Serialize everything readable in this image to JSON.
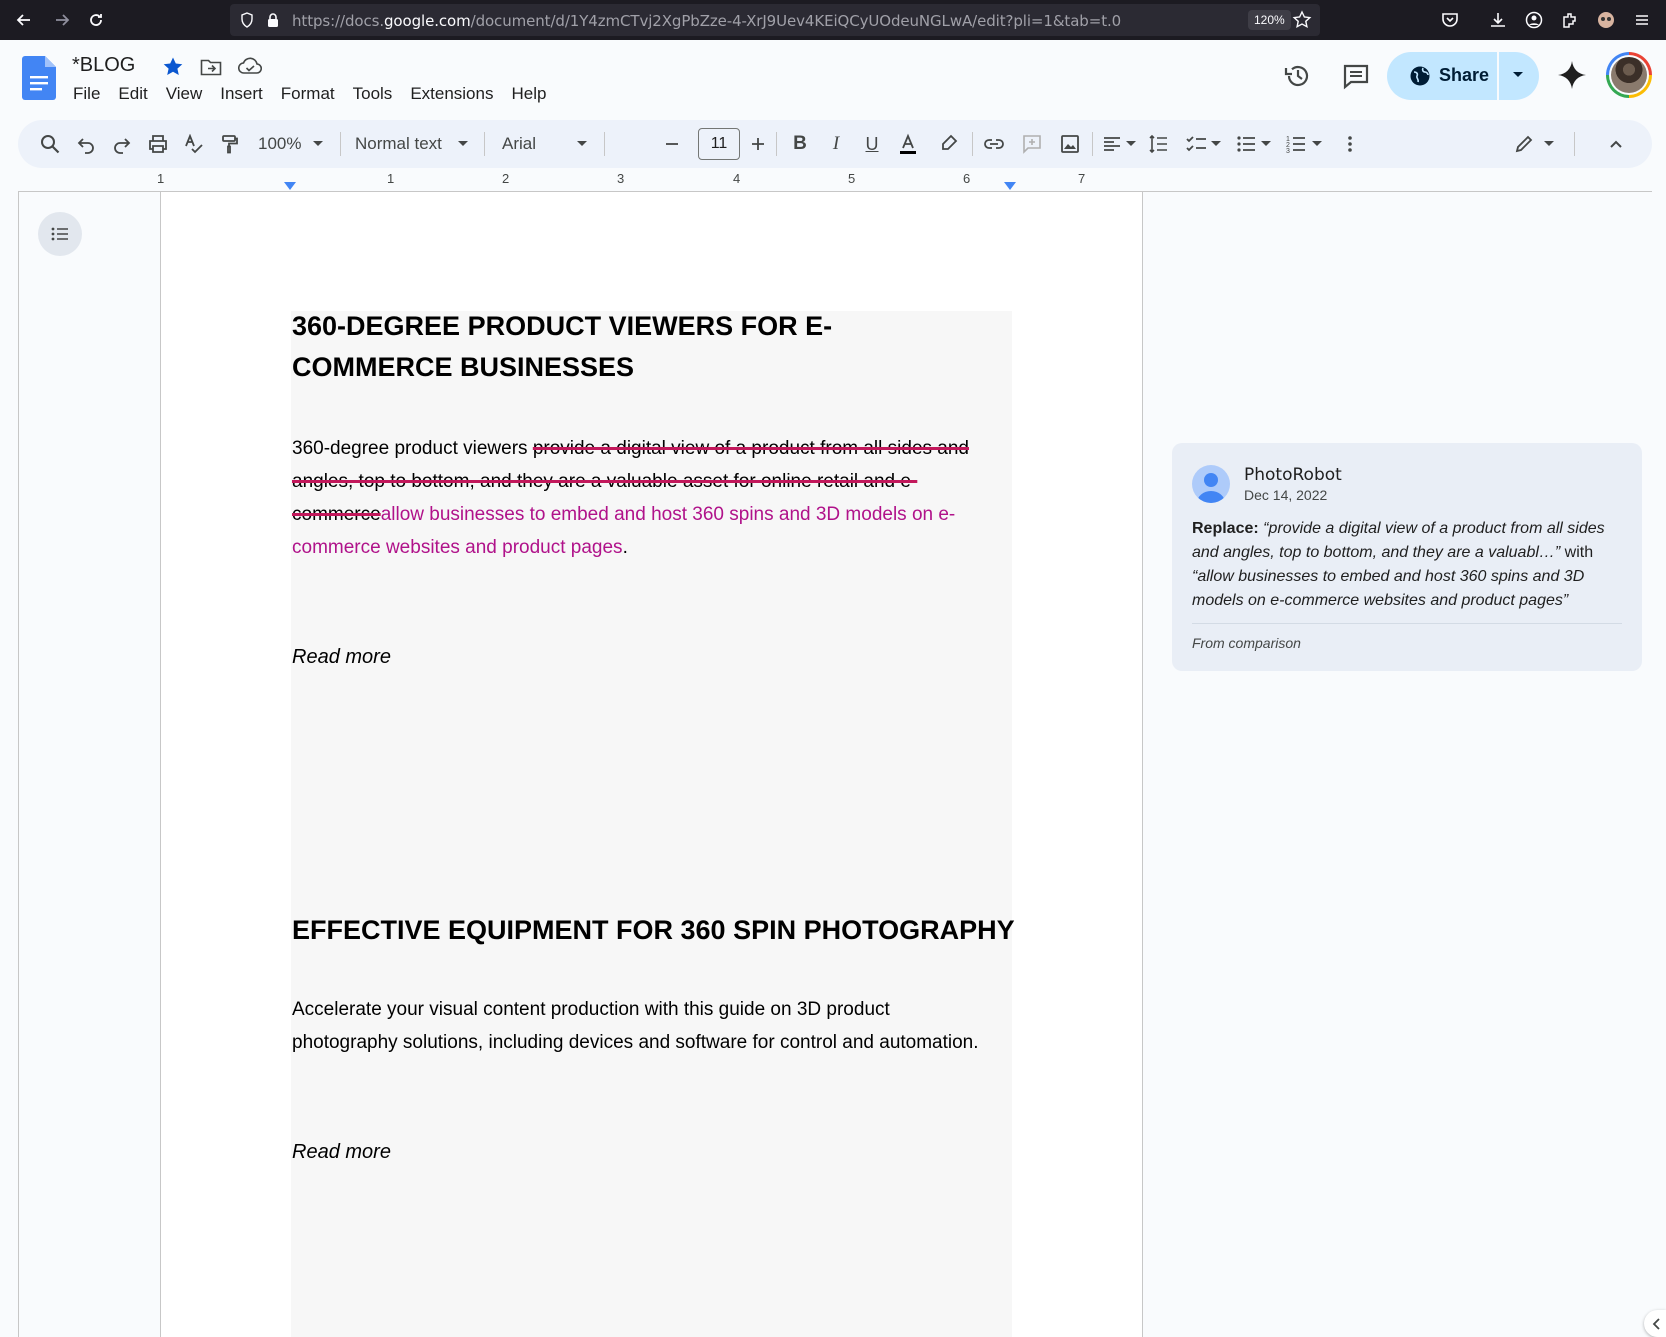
{
  "browser": {
    "url_prefix": "https://docs.",
    "url_domain": "google.com",
    "url_path": "/document/d/1Y4zmCTvj2XgPbZze-4-XrJ9Uev4KEiQCyUOdeuNGLwA/edit?pli=1&tab=t.0",
    "zoom": "120%"
  },
  "header": {
    "title": "*BLOG",
    "menus": [
      "File",
      "Edit",
      "View",
      "Insert",
      "Format",
      "Tools",
      "Extensions",
      "Help"
    ],
    "share_label": "Share"
  },
  "toolbar": {
    "zoom": "100%",
    "style": "Normal text",
    "font": "Arial",
    "font_size": "11"
  },
  "ruler": {
    "numbers": [
      "1",
      "1",
      "2",
      "3",
      "4",
      "5",
      "6",
      "7"
    ]
  },
  "document": {
    "heading1": "360-DEGREE PRODUCT VIEWERS FOR E-COMMERCE BUSINESSES",
    "para1_plain": "360-degree product viewers ",
    "para1_deleted": "provide a digital view of a product from all sides and angles, top to bottom, and they are a valuable asset for online retail and e-commerce",
    "para1_inserted": "allow businesses to embed and host 360 spins  and 3D models on e-commerce websites and product pages",
    "para1_end": ".",
    "read_more_1": "Read more",
    "heading2": "EFFECTIVE EQUIPMENT FOR 360 SPIN PHOTOGRAPHY",
    "para2": "Accelerate your visual content production with this guide on 3D product photography solutions, including devices and software for control and automation.",
    "read_more_2": "Read more"
  },
  "suggestion": {
    "author": "PhotoRobot",
    "date": "Dec 14, 2022",
    "action": "Replace:",
    "old_text": "“provide a digital view of a product from all sides and angles, top to bottom, and they are a valuabl…”",
    "with_word": " with ",
    "new_text": "“allow businesses to embed and host 360 spins and 3D models on e-commerce websites and product pages”",
    "source": "From comparison"
  },
  "colors": {
    "insert": "#b0128a",
    "strike": "#c2185b",
    "share_bg": "#c2e7ff",
    "toolbar_bg": "#edf2fa"
  }
}
